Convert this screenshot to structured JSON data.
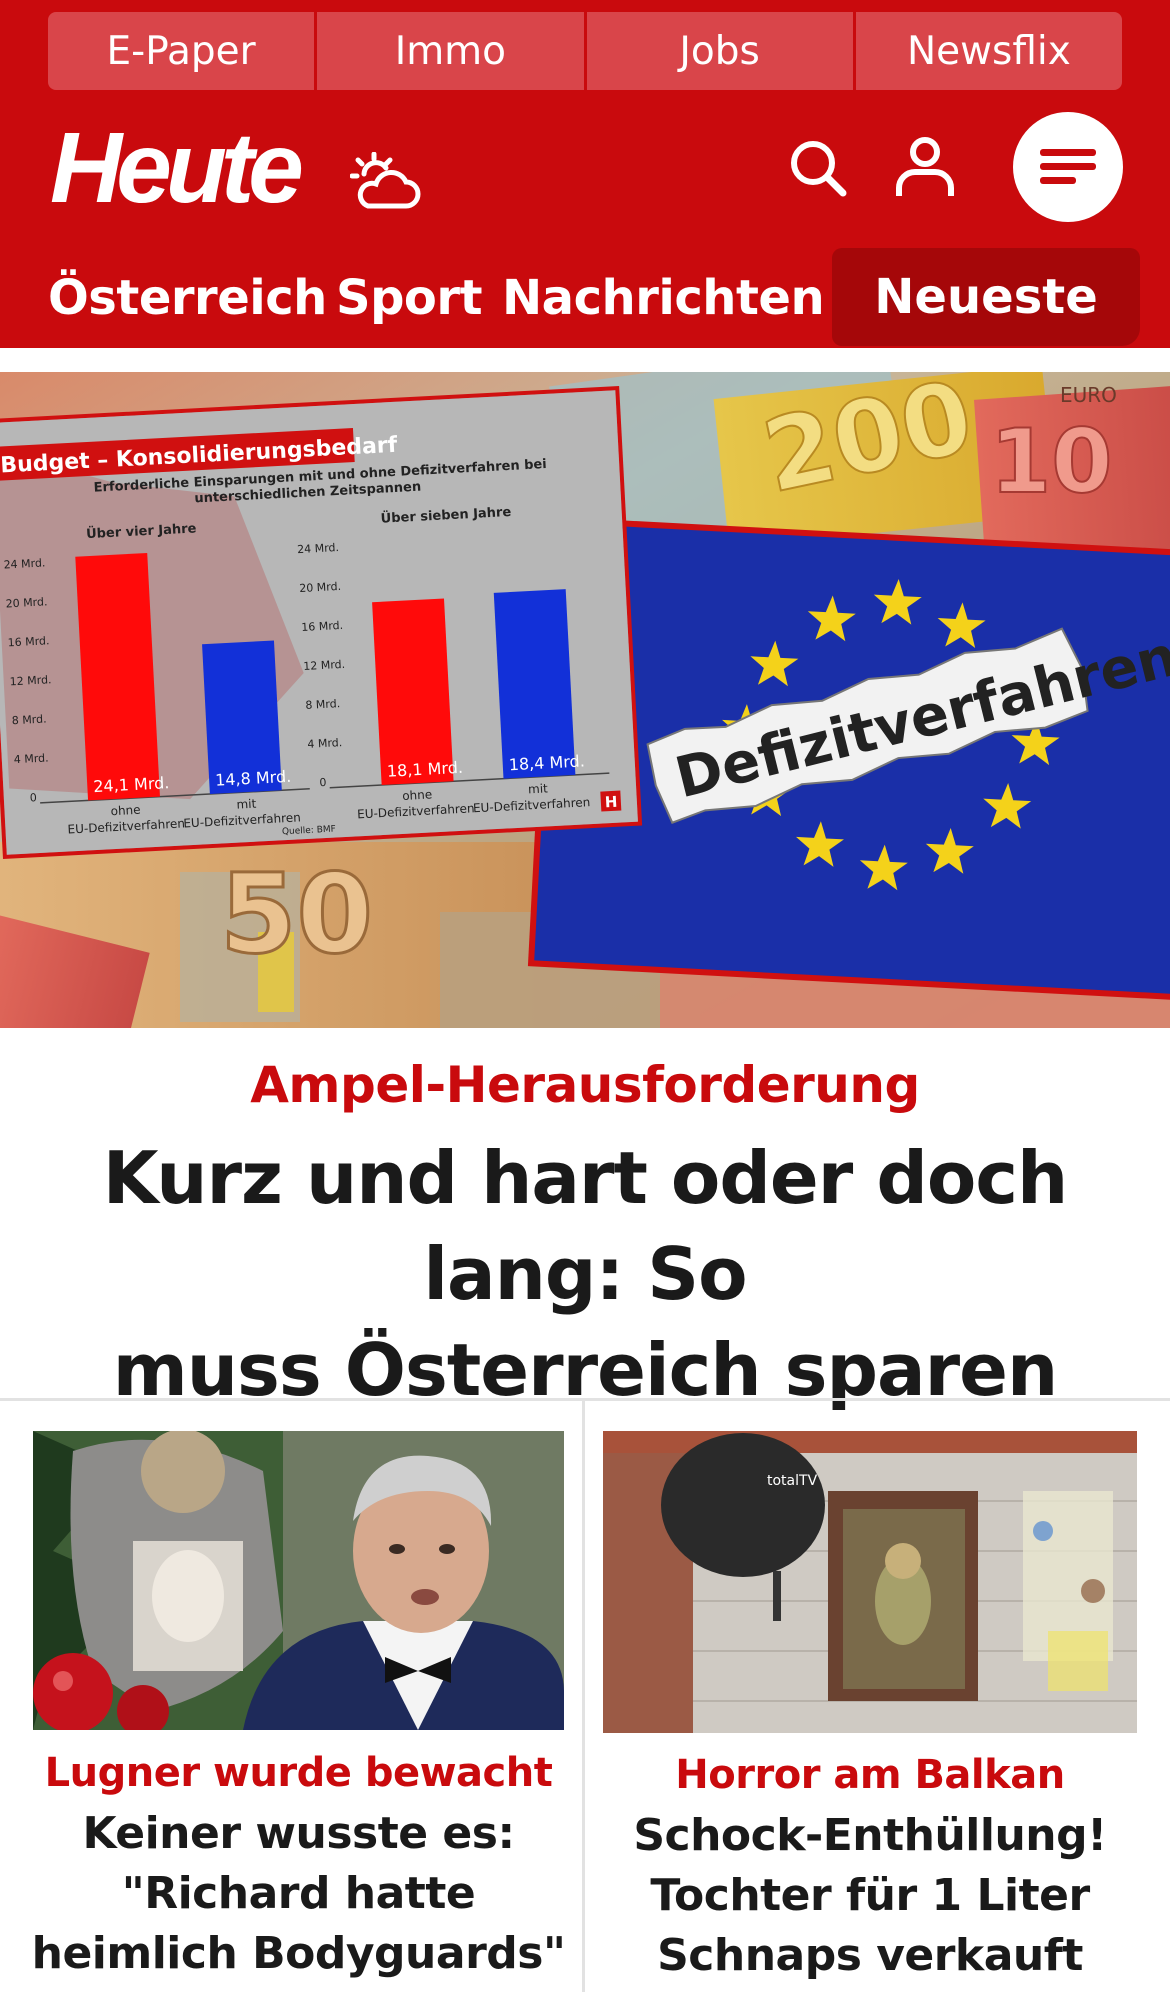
{
  "colors": {
    "brand_red": "#c90a0d",
    "dark_red": "#a50709",
    "text": "#1a1a1a"
  },
  "service_bar": {
    "items": [
      {
        "label": "E-Paper"
      },
      {
        "label": "Immo"
      },
      {
        "label": "Jobs"
      },
      {
        "label": "Newsflix"
      }
    ]
  },
  "header": {
    "logo": "Heute",
    "icons": [
      "weather-icon",
      "search-icon",
      "user-icon",
      "menu-icon"
    ]
  },
  "nav": {
    "items": [
      {
        "label": "Österreich"
      },
      {
        "label": "Sport"
      },
      {
        "label": "Nachrichten"
      }
    ],
    "highlight": "Neueste"
  },
  "hero": {
    "infographic": {
      "title": "Budget – Konsolidierungsbedarf",
      "subtitle_line1": "Erforderliche Einsparungen mit und ohne Defizitverfahren bei",
      "subtitle_line2": "unterschiedlichen Zeitspannen",
      "period_left": "Über vier Jahre",
      "period_right": "Über sieben Jahre",
      "ticks": [
        "24 Mrd.",
        "20 Mrd.",
        "16 Mrd.",
        "12 Mrd.",
        "8 Mrd.",
        "4 Mrd.",
        "0"
      ],
      "bar_labels": [
        "24,1 Mrd.",
        "14,8 Mrd.",
        "18,1 Mrd.",
        "18,4 Mrd."
      ],
      "cat_ohne_1": "ohne",
      "cat_ohne_2": "EU-Defizitverfahren",
      "cat_mit_1": "mit",
      "cat_mit_2": "EU-Defizitverfahren",
      "source": "Quelle: BMF",
      "badge": "H"
    },
    "note_text": "Defizitverfahren",
    "banknote_200": "200",
    "banknote_50": "50",
    "banknote_10": "10",
    "euro_label": "EURO",
    "kicker": "Ampel-Herausforderung",
    "headline_line1": "Kurz und hart oder doch lang: So",
    "headline_line2": "muss Österreich sparen"
  },
  "teasers": [
    {
      "kicker": "Lugner wurde bewacht",
      "title_line1": "Keiner wusste es:",
      "title_line2": "\"Richard hatte",
      "title_line3": "heimlich Bodyguards\""
    },
    {
      "kicker": "Horror am Balkan",
      "title_line1": "Schock-Enthüllung!",
      "title_line2": "Tochter für 1 Liter",
      "title_line3": "Schnaps verkauft",
      "dish_brand": "totalTV"
    }
  ]
}
